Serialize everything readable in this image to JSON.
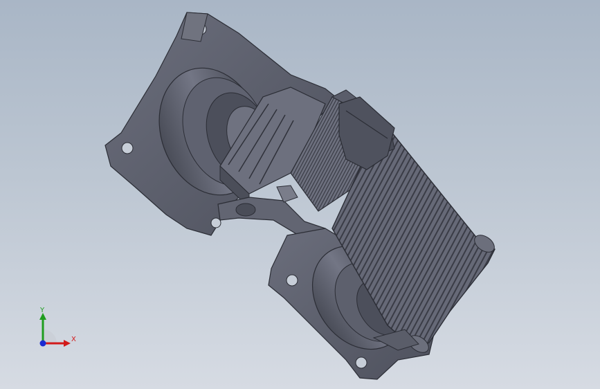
{
  "viewport": {
    "name": "3d-model-viewport",
    "background_top": "#a9b6c6",
    "background_bottom": "#d6dbe3",
    "model_color": "#5b5e6b",
    "model_edge_color": "#2b2d35"
  },
  "triad": {
    "x_label": "X",
    "y_label": "Y",
    "x_color": "#d21a1a",
    "y_color": "#1f9d1f",
    "z_color": "#1a2ad2"
  }
}
